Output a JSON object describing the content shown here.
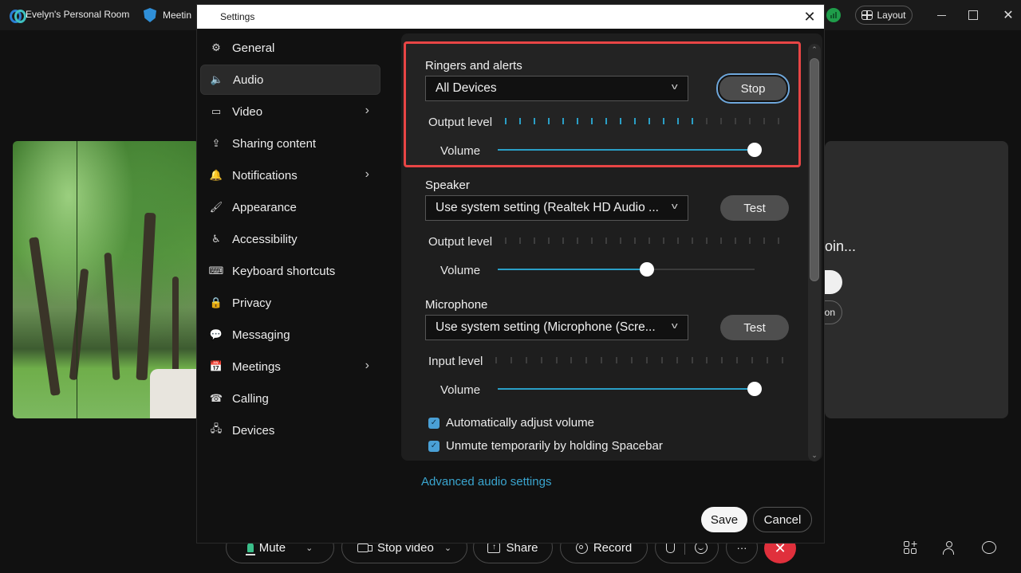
{
  "topbar": {
    "room_name": "Evelyn's Personal Room",
    "meeting_info_label": "Meetin",
    "layout_label": "Layout",
    "icons": {
      "app_logo": "webex-logo-icon",
      "shield": "shield-icon",
      "network": "network-health-icon",
      "layout": "grid-layout-icon",
      "minimize": "minimize-icon",
      "maximize": "maximize-icon",
      "close": "close-icon"
    },
    "close_glyph": "✕"
  },
  "stage": {
    "waiting_text": "oin...",
    "partial_button_label": "on"
  },
  "settings": {
    "title": "Settings",
    "close_glyph": "✕",
    "nav": [
      {
        "label": "General",
        "icon": "⚙",
        "has_submenu": false,
        "active": false
      },
      {
        "label": "Audio",
        "icon": "🔈",
        "has_submenu": false,
        "active": true
      },
      {
        "label": "Video",
        "icon": "▭",
        "has_submenu": true,
        "active": false
      },
      {
        "label": "Sharing content",
        "icon": "⇪",
        "has_submenu": false,
        "active": false
      },
      {
        "label": "Notifications",
        "icon": "🔔",
        "has_submenu": true,
        "active": false
      },
      {
        "label": "Appearance",
        "icon": "🖌",
        "has_submenu": false,
        "active": false
      },
      {
        "label": "Accessibility",
        "icon": "♿",
        "has_submenu": false,
        "active": false
      },
      {
        "label": "Keyboard shortcuts",
        "icon": "⌨",
        "has_submenu": false,
        "active": false
      },
      {
        "label": "Privacy",
        "icon": "🔒",
        "has_submenu": false,
        "active": false
      },
      {
        "label": "Messaging",
        "icon": "💬",
        "has_submenu": false,
        "active": false
      },
      {
        "label": "Meetings",
        "icon": "📅",
        "has_submenu": true,
        "active": false
      },
      {
        "label": "Calling",
        "icon": "☎",
        "has_submenu": false,
        "active": false
      },
      {
        "label": "Devices",
        "icon": "🖧",
        "has_submenu": false,
        "active": false
      }
    ],
    "chevron_glyph": "›",
    "audio": {
      "ringers": {
        "title": "Ringers and alerts",
        "device": "All Devices",
        "button_label": "Stop",
        "level_label": "Output level",
        "level_active_ticks": 14,
        "level_total_ticks": 20,
        "volume_label": "Volume",
        "volume_percent": 100
      },
      "speaker": {
        "title": "Speaker",
        "device": "Use system setting (Realtek HD Audio ...",
        "button_label": "Test",
        "level_label": "Output level",
        "level_active_ticks": 0,
        "level_total_ticks": 20,
        "volume_label": "Volume",
        "volume_percent": 58
      },
      "microphone": {
        "title": "Microphone",
        "device": "Use system setting (Microphone (Scre...",
        "button_label": "Test",
        "level_label": "Input level",
        "level_active_ticks": 0,
        "level_total_ticks": 20,
        "volume_label": "Volume",
        "volume_percent": 100
      },
      "checkboxes": [
        {
          "label": "Automatically adjust volume",
          "checked": true
        },
        {
          "label": "Unmute temporarily by holding Spacebar",
          "checked": true
        }
      ],
      "advanced_link": "Advanced audio settings"
    },
    "save_label": "Save",
    "cancel_label": "Cancel",
    "colors": {
      "accent": "#2a9fc6",
      "highlight_border": "#e84545",
      "checkbox": "#4aa0d6",
      "link": "#3aa5cf"
    }
  },
  "toolbar": {
    "mute_label": "Mute",
    "stop_video_label": "Stop video",
    "share_label": "Share",
    "record_label": "Record",
    "more_glyph": "···",
    "end_glyph": "✕",
    "caret_glyph": "⌄",
    "end_color": "#e0303c"
  }
}
